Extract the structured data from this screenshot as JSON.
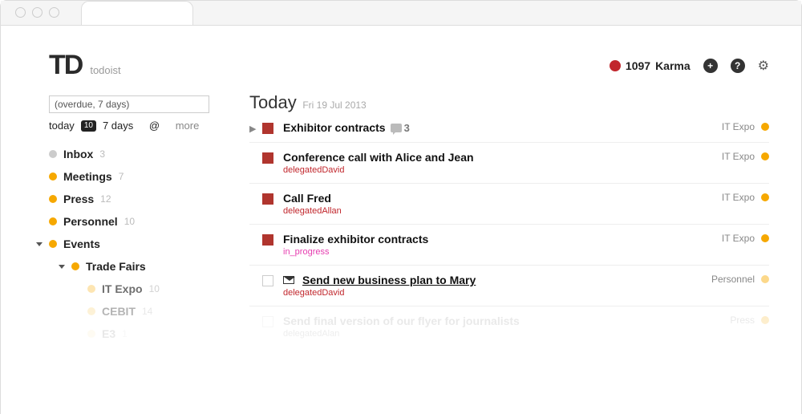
{
  "app": {
    "name": "todoist",
    "logo": "TD"
  },
  "header": {
    "karma": {
      "value": 1097,
      "label": "Karma"
    }
  },
  "sidebar": {
    "filter": "(overdue, 7 days)",
    "views": {
      "today": "today",
      "today_count": 10,
      "days7": "7 days",
      "at": "@",
      "more": "more"
    },
    "projects": [
      {
        "name": "Inbox",
        "count": 3,
        "color": "grey"
      },
      {
        "name": "Meetings",
        "count": 7,
        "color": "orange"
      },
      {
        "name": "Press",
        "count": 12,
        "color": "orange"
      },
      {
        "name": "Personnel",
        "count": 10,
        "color": "orange"
      },
      {
        "name": "Events",
        "count": "",
        "color": "orange",
        "expanded": true
      },
      {
        "name": "Trade Fairs",
        "count": "",
        "color": "orange",
        "sub": 1,
        "expanded": true
      },
      {
        "name": "IT Expo",
        "count": 10,
        "color": "orangelt",
        "sub": 2
      },
      {
        "name": "CEBIT",
        "count": 14,
        "color": "orangelt",
        "sub": 2
      },
      {
        "name": "E3",
        "count": 1,
        "color": "orangelt",
        "sub": 2
      }
    ]
  },
  "main": {
    "title": "Today",
    "date": "Fri 19 Jul 2013",
    "tasks": [
      {
        "title": "Exhibitor contracts",
        "comments": 3,
        "project": "IT Expo",
        "pcolor": "orange",
        "priority": true,
        "handle": true
      },
      {
        "title": "Conference call with Alice and Jean",
        "sub": "delegatedDavid",
        "subcolor": "red",
        "project": "IT Expo",
        "pcolor": "orange",
        "priority": true
      },
      {
        "title": "Call Fred",
        "sub": "delegatedAllan",
        "subcolor": "red",
        "project": "IT Expo",
        "pcolor": "orange",
        "priority": true
      },
      {
        "title": "Finalize exhibitor contracts",
        "sub": "in_progress",
        "subcolor": "pink",
        "project": "IT Expo",
        "pcolor": "orange",
        "priority": true
      },
      {
        "title": "Send new business plan to Mary",
        "sub": "delegatedDavid",
        "subcolor": "red",
        "project": "Personnel",
        "pcolor": "orangelt",
        "underline": true,
        "mail": true
      },
      {
        "title": "Send final version of our flyer for journalists",
        "sub": "delegatedAlan",
        "subcolor": "red",
        "project": "Press",
        "pcolor": "orangelt",
        "faded": true
      }
    ]
  }
}
